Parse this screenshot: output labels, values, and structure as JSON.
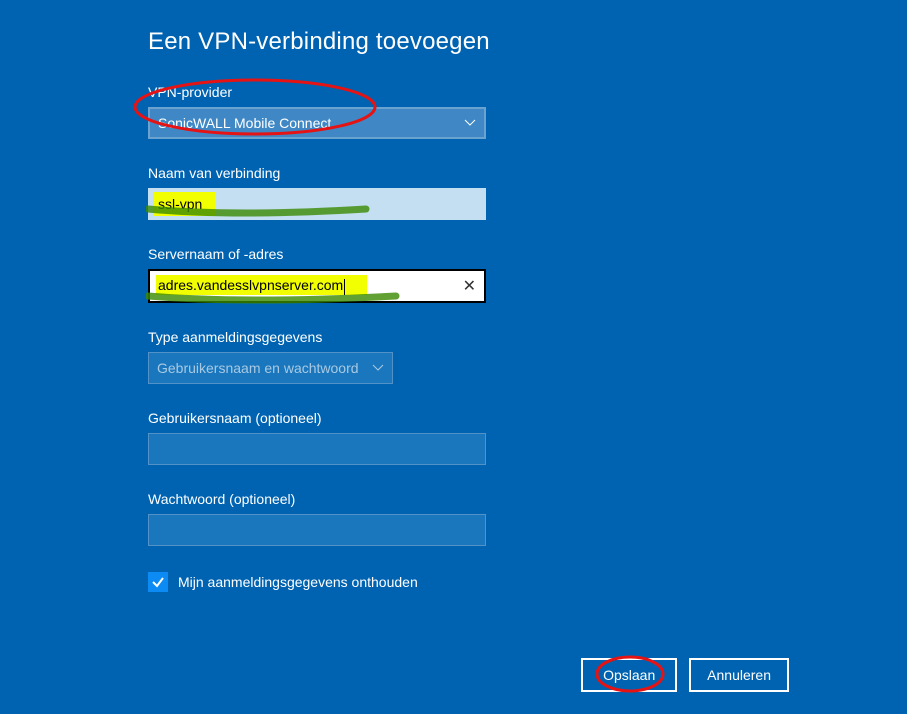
{
  "title": "Een VPN-verbinding toevoegen",
  "provider": {
    "label": "VPN-provider",
    "value": "SonicWALL Mobile Connect"
  },
  "connectionName": {
    "label": "Naam van verbinding",
    "value": "ssl-vpn"
  },
  "server": {
    "label": "Servernaam of -adres",
    "value": "adres.vandesslvpnserver.com"
  },
  "signinType": {
    "label": "Type aanmeldingsgegevens",
    "value": "Gebruikersnaam en wachtwoord"
  },
  "username": {
    "label": "Gebruikersnaam (optioneel)",
    "value": ""
  },
  "password": {
    "label": "Wachtwoord (optioneel)",
    "value": ""
  },
  "remember": {
    "label": "Mijn aanmeldingsgegevens onthouden",
    "checked": true
  },
  "buttons": {
    "save": "Opslaan",
    "cancel": "Annuleren"
  }
}
